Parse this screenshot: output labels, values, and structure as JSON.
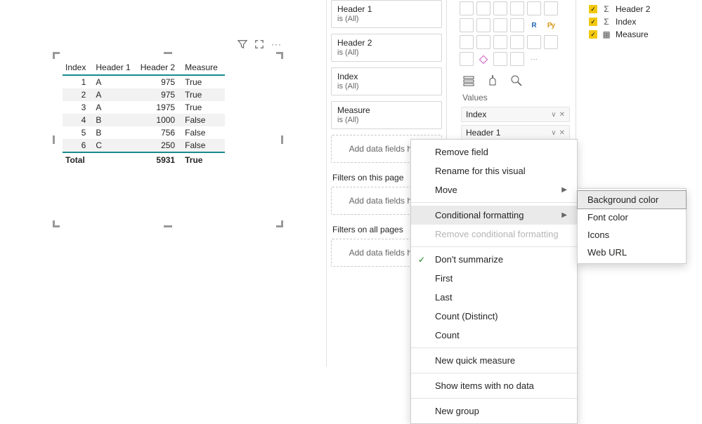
{
  "visual_toolbar": {
    "more": "···"
  },
  "table": {
    "headers": [
      "Index",
      "Header 1",
      "Header 2",
      "Measure"
    ],
    "rows": [
      {
        "index": "1",
        "h1": "A",
        "h2": "975",
        "measure": "True"
      },
      {
        "index": "2",
        "h1": "A",
        "h2": "975",
        "measure": "True"
      },
      {
        "index": "3",
        "h1": "A",
        "h2": "1975",
        "measure": "True"
      },
      {
        "index": "4",
        "h1": "B",
        "h2": "1000",
        "measure": "False"
      },
      {
        "index": "5",
        "h1": "B",
        "h2": "756",
        "measure": "False"
      },
      {
        "index": "6",
        "h1": "C",
        "h2": "250",
        "measure": "False"
      }
    ],
    "total_label": "Total",
    "total_h2": "5931",
    "total_measure": "True"
  },
  "filters": {
    "cards": [
      {
        "name": "Header 1",
        "val": "is (All)"
      },
      {
        "name": "Header 2",
        "val": "is (All)"
      },
      {
        "name": "Index",
        "val": "is (All)"
      },
      {
        "name": "Measure",
        "val": "is (All)"
      }
    ],
    "add_here": "Add data fields here",
    "section_page": "Filters on this page",
    "section_all": "Filters on all pages"
  },
  "viz_pane": {
    "values_label": "Values",
    "wells": [
      "Index",
      "Header 1"
    ]
  },
  "fields": {
    "items": [
      {
        "icon": "Σ",
        "label": "Header 2"
      },
      {
        "icon": "Σ",
        "label": "Index"
      },
      {
        "icon": "▦",
        "label": "Measure"
      }
    ]
  },
  "context_menu": {
    "remove_field": "Remove field",
    "rename": "Rename for this visual",
    "move": "Move",
    "cond_fmt": "Conditional formatting",
    "remove_cond": "Remove conditional formatting",
    "dont_summarize": "Don't summarize",
    "first": "First",
    "last": "Last",
    "count_distinct": "Count (Distinct)",
    "count": "Count",
    "new_quick": "New quick measure",
    "show_no_data": "Show items with no data",
    "new_group": "New group"
  },
  "submenu": {
    "bg": "Background color",
    "font": "Font color",
    "icons": "Icons",
    "url": "Web URL"
  }
}
